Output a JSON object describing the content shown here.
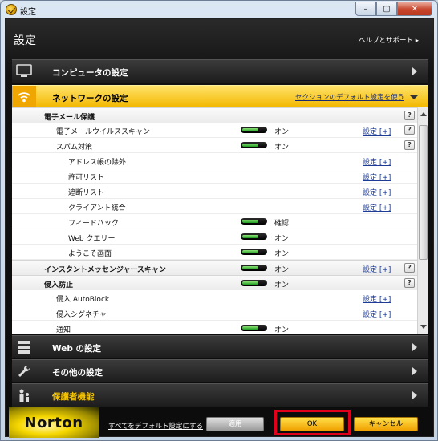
{
  "window": {
    "title": "設定",
    "minimize_glyph": "–",
    "maximize_glyph": "▢",
    "close_glyph": "✕"
  },
  "header": {
    "title": "設定",
    "help_link": "ヘルプとサポート ▸"
  },
  "categories": {
    "computer": {
      "label": "コンピュータの設定",
      "icon": "monitor-icon"
    },
    "network": {
      "label": "ネットワークの設定",
      "icon": "wifi-icon",
      "default_link": "セクションのデフォルト設定を使う"
    },
    "web": {
      "label": "Web の設定",
      "icon": "server-icon"
    },
    "other": {
      "label": "その他の設定",
      "icon": "wrench-icon"
    },
    "parental": {
      "label": "保護者機能",
      "icon": "family-icon"
    }
  },
  "rows": [
    {
      "label": "電子メール保護",
      "group": true,
      "toggle": false,
      "state": "",
      "setting": "",
      "help": "?"
    },
    {
      "label": "電子メールウイルススキャン",
      "group": false,
      "toggle": true,
      "state": "オン",
      "setting": "設定 [+]",
      "help": "?"
    },
    {
      "label": "スパム対策",
      "group": false,
      "toggle": true,
      "state": "オン",
      "setting": "",
      "help": "?"
    },
    {
      "label": "アドレス帳の除外",
      "group": false,
      "toggle": false,
      "state": "",
      "setting": "設定 [+]",
      "help": ""
    },
    {
      "label": "許可リスト",
      "group": false,
      "toggle": false,
      "state": "",
      "setting": "設定 [+]",
      "help": ""
    },
    {
      "label": "遮断リスト",
      "group": false,
      "toggle": false,
      "state": "",
      "setting": "設定 [+]",
      "help": ""
    },
    {
      "label": "クライアント統合",
      "group": false,
      "toggle": false,
      "state": "",
      "setting": "設定 [+]",
      "help": ""
    },
    {
      "label": "フィードバック",
      "group": false,
      "toggle": true,
      "state": "確認",
      "setting": "",
      "help": ""
    },
    {
      "label": "Web クエリー",
      "group": false,
      "toggle": true,
      "state": "オン",
      "setting": "",
      "help": ""
    },
    {
      "label": "ようこそ画面",
      "group": false,
      "toggle": true,
      "state": "オン",
      "setting": "",
      "help": ""
    },
    {
      "label": "インスタントメッセンジャースキャン",
      "group": true,
      "toggle": true,
      "state": "オン",
      "setting": "設定 [+]",
      "help": "?"
    },
    {
      "label": "侵入防止",
      "group": true,
      "toggle": true,
      "state": "オン",
      "setting": "",
      "help": "?"
    },
    {
      "label": "侵入 AutoBlock",
      "group": false,
      "toggle": false,
      "state": "",
      "setting": "設定 [+]",
      "help": ""
    },
    {
      "label": "侵入シグネチャ",
      "group": false,
      "toggle": false,
      "state": "",
      "setting": "設定 [+]",
      "help": ""
    },
    {
      "label": "通知",
      "group": false,
      "toggle": true,
      "state": "オン",
      "setting": "",
      "help": ""
    }
  ],
  "footer": {
    "logo": "Norton",
    "reset_link": "すべてをデフォルト設定にする",
    "apply": "適用",
    "ok": "OK",
    "cancel": "キャンセル"
  }
}
